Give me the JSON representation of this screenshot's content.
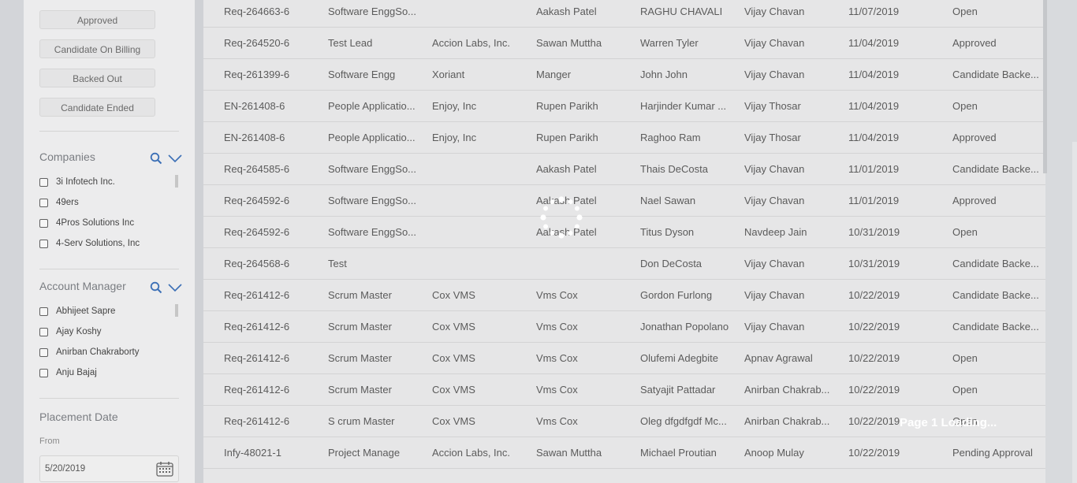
{
  "sidebar": {
    "status_buttons": [
      "Approved",
      "Candidate On Billing",
      "Backed Out",
      "Candidate Ended"
    ],
    "companies": {
      "title": "Companies",
      "items": [
        "3i Infotech Inc.",
        "49ers",
        "4Pros Solutions Inc",
        "4-Serv Solutions, Inc"
      ]
    },
    "account_manager": {
      "title": "Account Manager",
      "items": [
        "Abhijeet Sapre",
        "Ajay Koshy",
        "Anirban Chakraborty",
        "Anju Bajaj"
      ]
    },
    "placement_date": {
      "title": "Placement Date",
      "from_label": "From",
      "from_value": "5/20/2019"
    }
  },
  "table": {
    "rows": [
      [
        "Req-264663-6",
        "Software EnggSo...",
        "",
        "Aakash Patel",
        "RAGHU CHAVALI",
        "Vijay Chavan",
        "11/07/2019",
        "Open"
      ],
      [
        "Req-264520-6",
        "Test Lead",
        "Accion Labs, Inc.",
        "Sawan Muttha",
        "Warren Tyler",
        "Vijay Chavan",
        "11/04/2019",
        "Approved"
      ],
      [
        "Req-261399-6",
        "Software Engg",
        "Xoriant",
        "Manger",
        "John John",
        "Vijay Chavan",
        "11/04/2019",
        "Candidate Backe..."
      ],
      [
        "EN-261408-6",
        "People Applicatio...",
        "Enjoy, Inc",
        "Rupen Parikh",
        "Harjinder Kumar ...",
        "Vijay Thosar",
        "11/04/2019",
        "Open"
      ],
      [
        "EN-261408-6",
        "People Applicatio...",
        "Enjoy, Inc",
        "Rupen Parikh",
        "Raghoo Ram",
        "Vijay Thosar",
        "11/04/2019",
        "Approved"
      ],
      [
        "Req-264585-6",
        "Software EnggSo...",
        "",
        "Aakash Patel",
        "Thais DeCosta",
        "Vijay Chavan",
        "11/01/2019",
        "Candidate Backe..."
      ],
      [
        "Req-264592-6",
        "Software EnggSo...",
        "",
        "Aakash Patel",
        "Nael Sawan",
        "Vijay Chavan",
        "11/01/2019",
        "Approved"
      ],
      [
        "Req-264592-6",
        "Software EnggSo...",
        "",
        "Aakash Patel",
        "Titus Dyson",
        "Navdeep Jain",
        "10/31/2019",
        "Open"
      ],
      [
        "Req-264568-6",
        "Test",
        "",
        "",
        "Don DeCosta",
        "Vijay Chavan",
        "10/31/2019",
        "Candidate Backe..."
      ],
      [
        "Req-261412-6",
        "Scrum Master",
        "Cox VMS",
        "Vms Cox",
        "Gordon Furlong",
        "Vijay Chavan",
        "10/22/2019",
        "Candidate Backe..."
      ],
      [
        "Req-261412-6",
        "Scrum Master",
        "Cox VMS",
        "Vms Cox",
        "Jonathan Popolano",
        "Vijay Chavan",
        "10/22/2019",
        "Candidate Backe..."
      ],
      [
        "Req-261412-6",
        "Scrum Master",
        "Cox VMS",
        "Vms Cox",
        "Olufemi Adegbite",
        "Apnav Agrawal",
        "10/22/2019",
        "Open"
      ],
      [
        "Req-261412-6",
        "Scrum Master",
        "Cox VMS",
        "Vms Cox",
        "Satyajit Pattadar",
        "Anirban Chakrab...",
        "10/22/2019",
        "Open"
      ],
      [
        "Req-261412-6",
        "S crum Master",
        "Cox VMS",
        "Vms Cox",
        "Oleg dfgdfgdf Mc...",
        "Anirban Chakrab...",
        "10/22/2019",
        "Open"
      ],
      [
        "Infy-48021-1",
        "Project Manage",
        "Accion Labs, Inc.",
        "Sawan Muttha",
        "Michael Proutian",
        "Anoop Mulay",
        "10/22/2019",
        "Pending Approval"
      ]
    ]
  },
  "overlay": {
    "loading_text": "Page 1 Loading..."
  },
  "colors": {
    "overlay_tint": "#8c8f96",
    "sidebar_bg": "#ececed",
    "table_bg": "#e6e6e7",
    "accent_icon": "#3b6fb6"
  },
  "icons": [
    "search-icon",
    "chevron-down-icon",
    "calendar-icon",
    "spinner-icon"
  ]
}
